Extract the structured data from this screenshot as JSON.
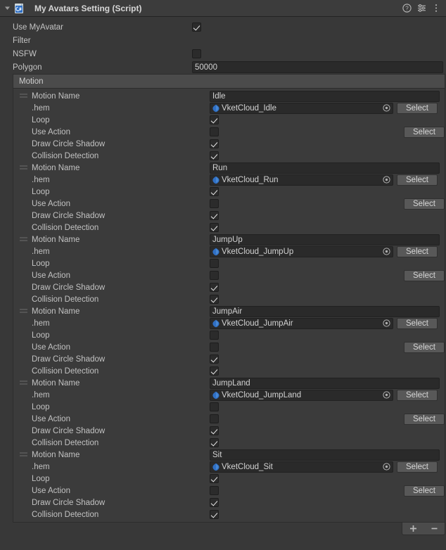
{
  "header": {
    "title": "My Avatars Setting (Script)",
    "foldout_icon": "triangle-down-icon",
    "script_icon": "csharp-script-icon",
    "help_icon": "help-icon",
    "preset_icon": "preset-icon",
    "menu_icon": "kebab-menu-icon"
  },
  "properties": {
    "use_my_avatar": {
      "label": "Use MyAvatar",
      "checked": true
    },
    "filter": {
      "label": "Filter"
    },
    "nsfw": {
      "label": "NSFW",
      "checked": false
    },
    "polygon": {
      "label": "Polygon",
      "value": "50000"
    }
  },
  "motion_list": {
    "header_label": "Motion",
    "row_labels": {
      "motion_name": "Motion Name",
      "hem": ".hem",
      "loop": "Loop",
      "use_action": "Use Action",
      "draw_circle_shadow": "Draw Circle Shadow",
      "collision_detection": "Collision Detection"
    },
    "select_label": "Select",
    "add_label": "+",
    "remove_label": "–",
    "items": [
      {
        "motion_name": "Idle",
        "hem": "VketCloud_Idle",
        "loop": true,
        "use_action": false,
        "draw_circle_shadow": true,
        "collision_detection": true
      },
      {
        "motion_name": "Run",
        "hem": "VketCloud_Run",
        "loop": true,
        "use_action": false,
        "draw_circle_shadow": true,
        "collision_detection": true
      },
      {
        "motion_name": "JumpUp",
        "hem": "VketCloud_JumpUp",
        "loop": false,
        "use_action": false,
        "draw_circle_shadow": true,
        "collision_detection": true
      },
      {
        "motion_name": "JumpAir",
        "hem": "VketCloud_JumpAir",
        "loop": false,
        "use_action": false,
        "draw_circle_shadow": true,
        "collision_detection": true
      },
      {
        "motion_name": "JumpLand",
        "hem": "VketCloud_JumpLand",
        "loop": false,
        "use_action": false,
        "draw_circle_shadow": true,
        "collision_detection": true
      },
      {
        "motion_name": "Sit",
        "hem": "VketCloud_Sit",
        "loop": true,
        "use_action": false,
        "draw_circle_shadow": true,
        "collision_detection": true
      }
    ]
  },
  "colors": {
    "window_bg": "#383838",
    "header_bg": "#3c3c3c",
    "list_header_bg": "#4b4b4b",
    "list_body_bg": "#3b3b3b",
    "field_bg": "#2a2a2a",
    "button_bg": "#585858",
    "text": "#c4c4c4",
    "object_icon_blue": "#2f6fc4"
  }
}
